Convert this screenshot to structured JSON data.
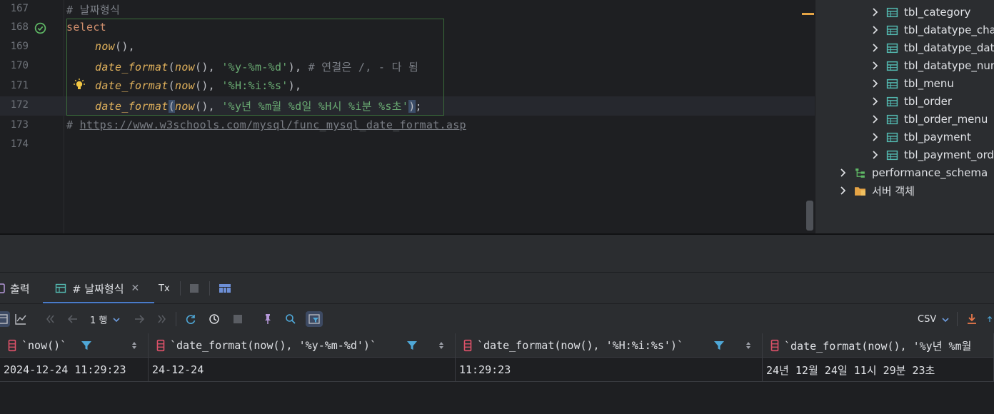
{
  "editor": {
    "lines": [
      {
        "num": "167",
        "comment": "# 날짜형식"
      },
      {
        "num": "168",
        "kw": "select"
      },
      {
        "num": "169",
        "fn": "now",
        "tail": "(),"
      },
      {
        "num": "170",
        "fn": "date_format",
        "inner_fn": "now",
        "str": "'%y-%m-%d'",
        "close": "),",
        "comment": " # 연결은 /, - 다 됨"
      },
      {
        "num": "171",
        "fn": "date_format",
        "inner_fn": "now",
        "str": "'%H:%i:%s'",
        "close": "),"
      },
      {
        "num": "172",
        "fn": "date_format",
        "inner_fn": "now",
        "str": "'%y년 %m월 %d일 %H시 %i분 %s초'",
        "close": ");"
      },
      {
        "num": "173",
        "hash": "# ",
        "link": "https://www.w3schools.com/mysql/func_mysql_date_format.asp"
      },
      {
        "num": "174"
      }
    ]
  },
  "tree": {
    "tables": [
      "tbl_category",
      "tbl_datatype_cha",
      "tbl_datatype_date",
      "tbl_datatype_num",
      "tbl_menu",
      "tbl_order",
      "tbl_order_menu",
      "tbl_payment",
      "tbl_payment_ord"
    ],
    "schema": "performance_schema",
    "server_objects": "서버 객체"
  },
  "tabs": {
    "output": "출력",
    "result": "# 날짜형식",
    "tx": "Tx"
  },
  "toolbar": {
    "page": "1 행",
    "export_format": "CSV"
  },
  "grid": {
    "columns": [
      "`now()`",
      "`date_format(now(), '%y-%m-%d')`",
      "`date_format(now(), '%H:%i:%s')`",
      "`date_format(now(), '%y년 %m월"
    ],
    "rows": [
      [
        "2024-12-24 11:29:23",
        "24-12-24",
        "11:29:23",
        "24년 12월 24일 11시 29분 23초"
      ]
    ]
  },
  "colors": {
    "keyword": "#cf8e6d",
    "function": "#e0b15c",
    "string": "#6aab73",
    "comment": "#7a7e85",
    "accent": "#4a7bc8"
  }
}
